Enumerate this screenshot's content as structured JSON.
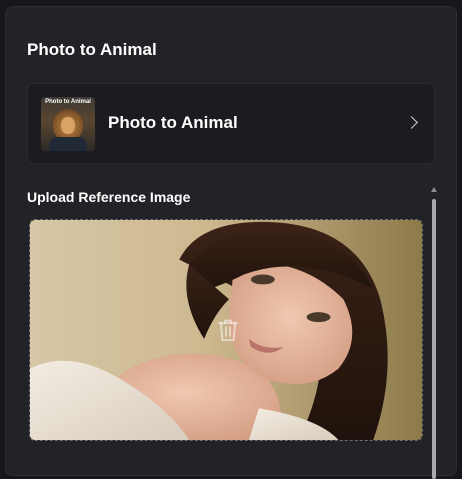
{
  "panel": {
    "title": "Photo to Animal"
  },
  "template_card": {
    "label": "Photo to Animal",
    "thumbnail_caption": "Photo to Animal",
    "chevron_icon": "chevron-right-icon"
  },
  "upload": {
    "section_label": "Upload Reference Image",
    "delete_icon": "trash-icon"
  }
}
